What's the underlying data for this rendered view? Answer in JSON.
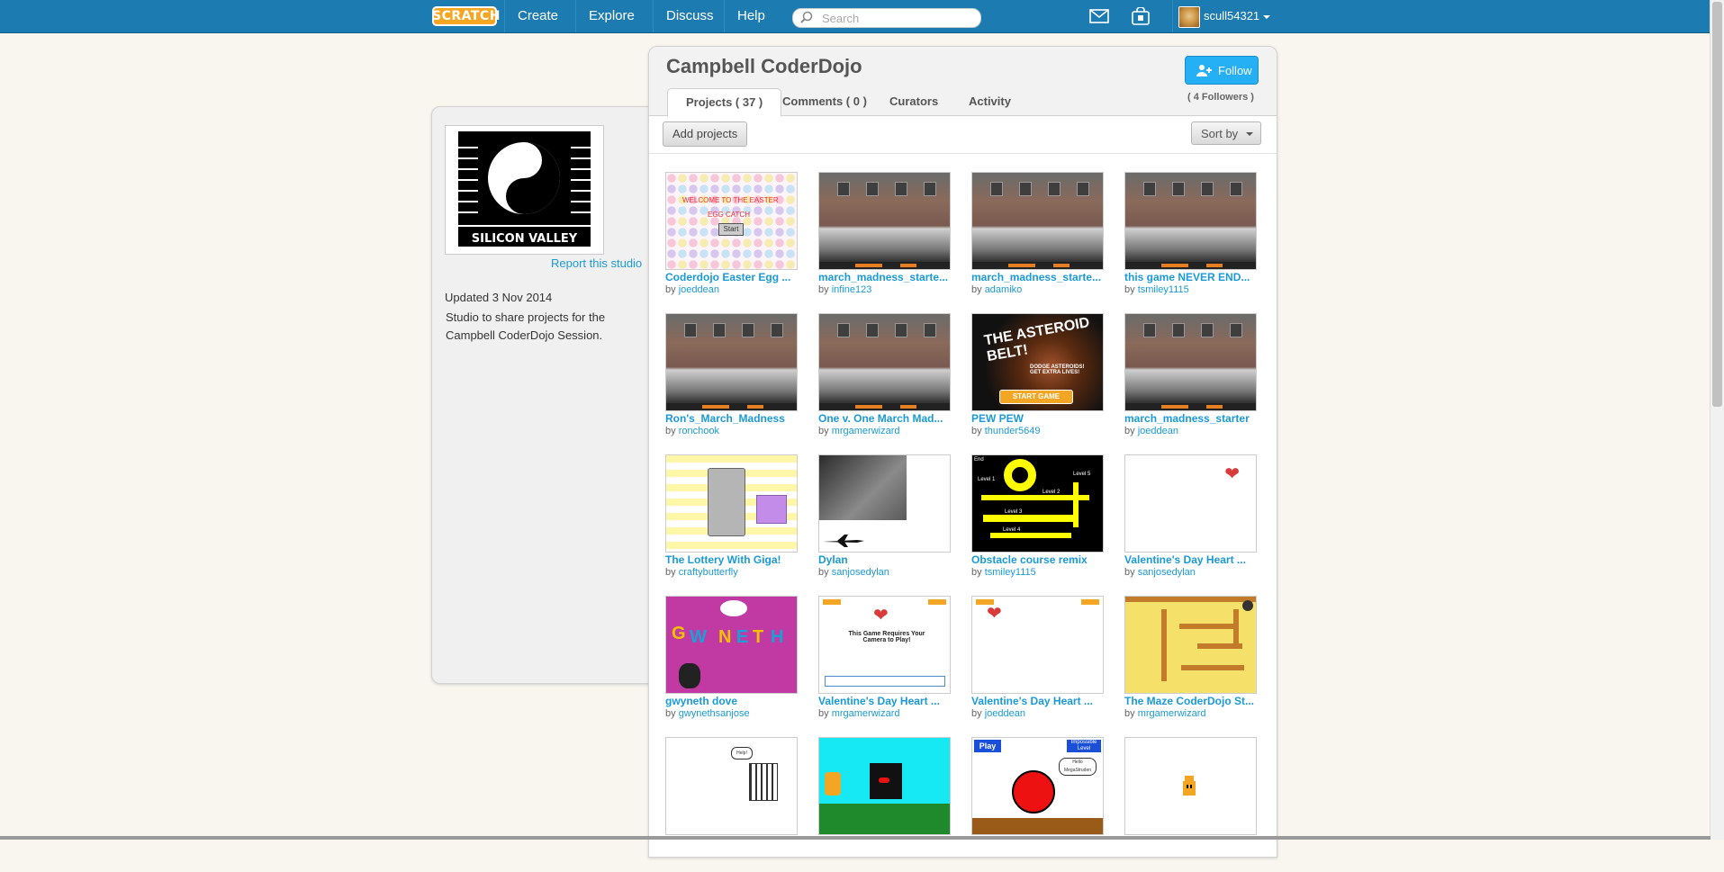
{
  "nav": {
    "logo": "SCRATCH",
    "links": [
      "Create",
      "Explore",
      "Discuss",
      "Help"
    ],
    "search_placeholder": "Search",
    "username": "scull54321"
  },
  "sidebar": {
    "report_link": "Report this studio",
    "updated": "Updated 3 Nov 2014",
    "description": "Studio to share projects for the Campbell CoderDojo Session.",
    "logo_label": "SILICON VALLEY"
  },
  "studio": {
    "title": "Campbell CoderDojo",
    "follow_label": "Follow",
    "followers": "( 4 Followers )",
    "tabs": [
      "Projects ( 37 )",
      "Comments ( 0 )",
      "Curators",
      "Activity"
    ],
    "active_tab": 0,
    "add_projects_label": "Add projects",
    "sort_label": "Sort by"
  },
  "projects": [
    {
      "title": "Coderdojo Easter Egg ...",
      "by_prefix": "by",
      "author": "joeddean",
      "thumb": "egg"
    },
    {
      "title": "march_madness_starte...",
      "by_prefix": "by",
      "author": "infine123",
      "thumb": "gym"
    },
    {
      "title": "march_madness_starte...",
      "by_prefix": "by",
      "author": "adamiko",
      "thumb": "gym"
    },
    {
      "title": "this game NEVER END...",
      "by_prefix": "by",
      "author": "tsmiley1115",
      "thumb": "gym"
    },
    {
      "title": "Ron's_March_Madness",
      "by_prefix": "by",
      "author": "ronchook",
      "thumb": "gym"
    },
    {
      "title": "One v. One March Mad...",
      "by_prefix": "by",
      "author": "mrgamerwizard",
      "thumb": "gym"
    },
    {
      "title": "PEW PEW",
      "by_prefix": "by",
      "author": "thunder5649",
      "thumb": "space"
    },
    {
      "title": "march_madness_starter",
      "by_prefix": "by",
      "author": "joeddean",
      "thumb": "gym"
    },
    {
      "title": "The Lottery With Giga!",
      "by_prefix": "by",
      "author": "craftybutterfly",
      "thumb": "lottery"
    },
    {
      "title": "Dylan",
      "by_prefix": "by",
      "author": "sanjosedylan",
      "thumb": "dylan"
    },
    {
      "title": "Obstacle course remix",
      "by_prefix": "by",
      "author": "tsmiley1115",
      "thumb": "maze"
    },
    {
      "title": "Valentine's Day Heart ...",
      "by_prefix": "by",
      "author": "sanjosedylan",
      "thumb": "heart"
    },
    {
      "title": "gwyneth dove",
      "by_prefix": "by",
      "author": "gwynethsanjose",
      "thumb": "gwyn"
    },
    {
      "title": "Valentine's Day Heart ...",
      "by_prefix": "by",
      "author": "mrgamerwizard",
      "thumb": "heart2"
    },
    {
      "title": "Valentine's Day Heart ...",
      "by_prefix": "by",
      "author": "joeddean",
      "thumb": "heart3"
    },
    {
      "title": "The Maze CoderDojo St...",
      "by_prefix": "by",
      "author": "mrgamerwizard",
      "thumb": "mazecd"
    },
    {
      "title": "",
      "by_prefix": "",
      "author": "",
      "thumb": "cage"
    },
    {
      "title": "",
      "by_prefix": "",
      "author": "",
      "thumb": "cat"
    },
    {
      "title": "",
      "by_prefix": "",
      "author": "",
      "thumb": "play"
    },
    {
      "title": "",
      "by_prefix": "",
      "author": "",
      "thumb": "cat2"
    }
  ],
  "thumb_text": {
    "egg_welcome": "WELCOME TO THE EASTER",
    "egg_game": "EGG CATCH",
    "egg_start": "Start",
    "space_title": "THE ASTEROID BELT!",
    "space_sub": "DODGE ASTEROIDS! GET EXTRA LIVES!",
    "space_btn": "START GAME",
    "maze_end": "End",
    "maze_l1": "Level 1",
    "maze_l2": "Level 2",
    "maze_l3": "Level 3",
    "maze_l4": "Level 4",
    "maze_l5": "Level 5",
    "heart2_text": "This Game Requires Your Camera to Play!",
    "cage_bubble": "Help!",
    "play_btn": "Play",
    "play_impossible": "Impossible Level",
    "play_bubble": "Hello MegaStruden",
    "gwyn_letters": [
      "G",
      "W",
      "N",
      "E",
      "T",
      "H"
    ]
  },
  "colors": {
    "nav_bg": "#1c7bb0",
    "link": "#1a9ad6",
    "follow_bg": "#25aff4",
    "page_bg": "#f8f6ef"
  }
}
